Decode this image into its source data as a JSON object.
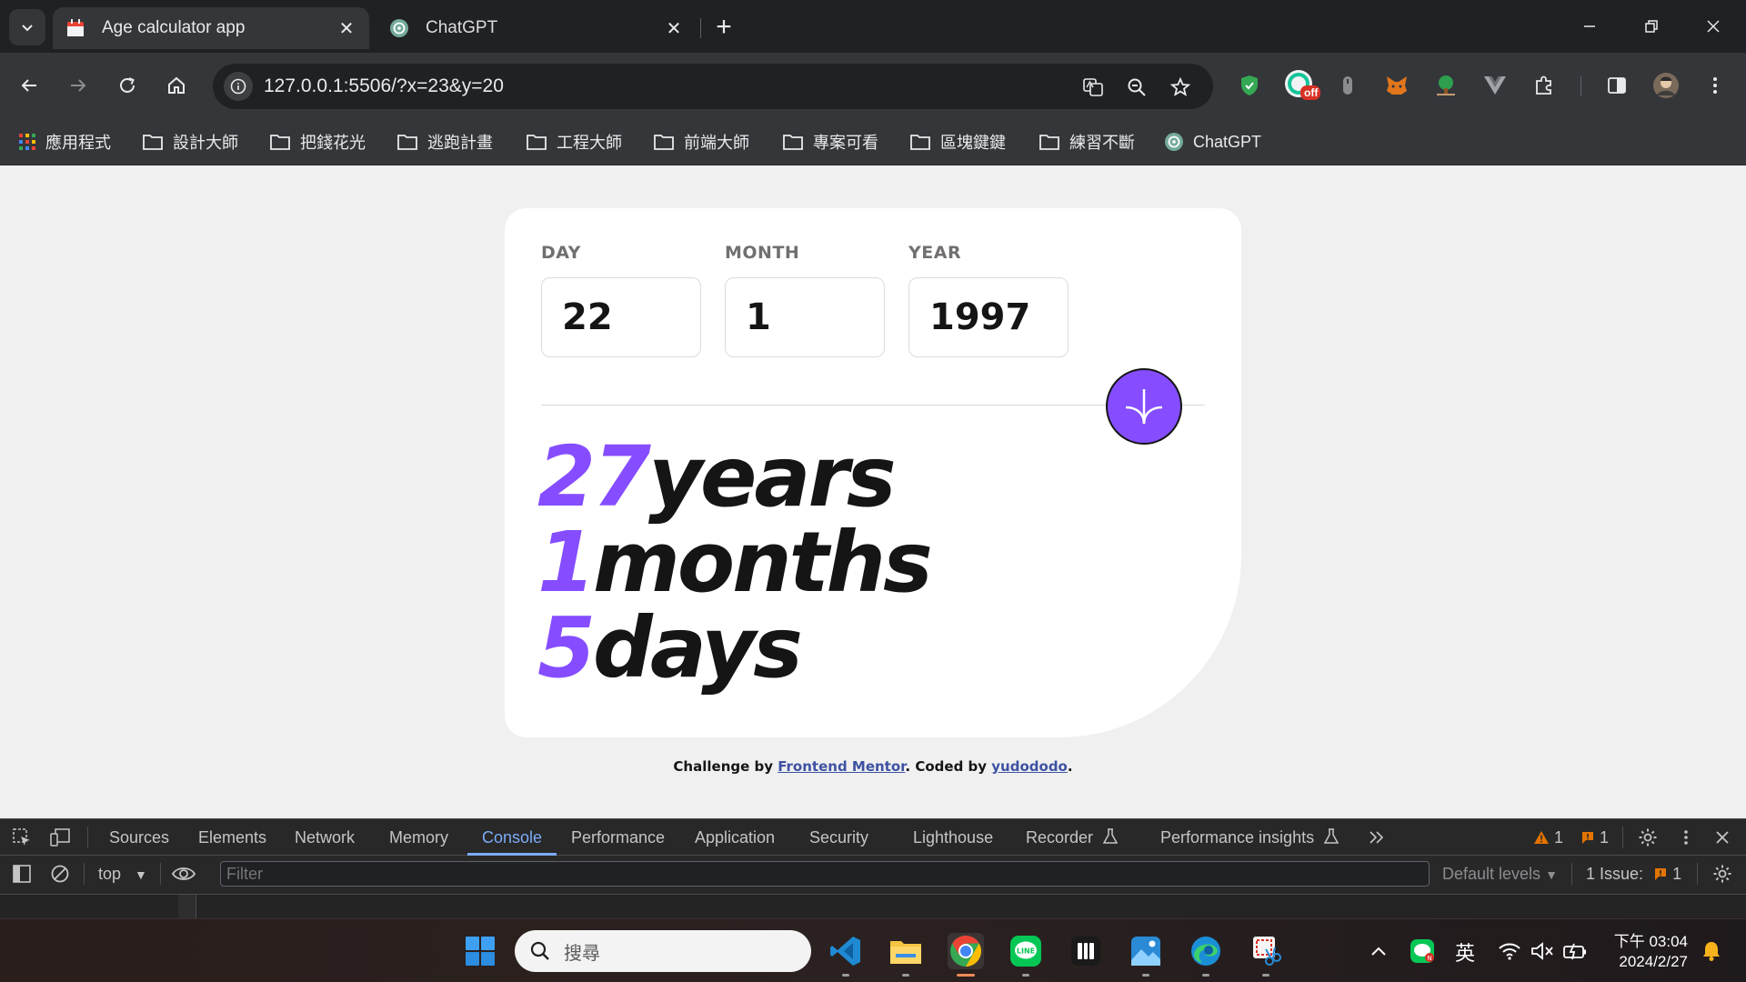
{
  "browser": {
    "tabs": [
      {
        "title": "Age calculator app",
        "active": true
      },
      {
        "title": "ChatGPT",
        "active": false
      }
    ],
    "url": "127.0.0.1:5506/?x=23&y=20",
    "bookmarks": [
      "應用程式",
      "設計大師",
      "把錢花光",
      "逃跑計畫",
      "工程大師",
      "前端大師",
      "專案可看",
      "區塊鍵鍵",
      "練習不斷",
      "ChatGPT"
    ],
    "extension_badge": "off"
  },
  "app": {
    "fields": [
      {
        "label": "DAY",
        "value": "22"
      },
      {
        "label": "MONTH",
        "value": "1"
      },
      {
        "label": "YEAR",
        "value": "1997"
      }
    ],
    "results": [
      {
        "value": "27",
        "unit": "years"
      },
      {
        "value": "1",
        "unit": "months"
      },
      {
        "value": "5",
        "unit": "days"
      }
    ],
    "accent_color": "#854dff",
    "attribution": {
      "prefix": "Challenge by",
      "link1": "Frontend Mentor",
      "middle": ". Coded by",
      "link2": "yudododo",
      "suffix": "."
    }
  },
  "devtools": {
    "tabs": [
      "Sources",
      "Elements",
      "Network",
      "Memory",
      "Console",
      "Performance",
      "Application",
      "Security",
      "Lighthouse",
      "Recorder",
      "Performance insights"
    ],
    "active_tab": "Console",
    "warnings_count": "1",
    "errors_count": "1",
    "context": "top",
    "filter_placeholder": "Filter",
    "levels": "Default levels",
    "issues_label": "1 Issue:",
    "issues_count": "1"
  },
  "taskbar": {
    "search_placeholder": "搜尋",
    "ime": "英",
    "time": "下午 03:04",
    "date": "2024/2/27"
  }
}
